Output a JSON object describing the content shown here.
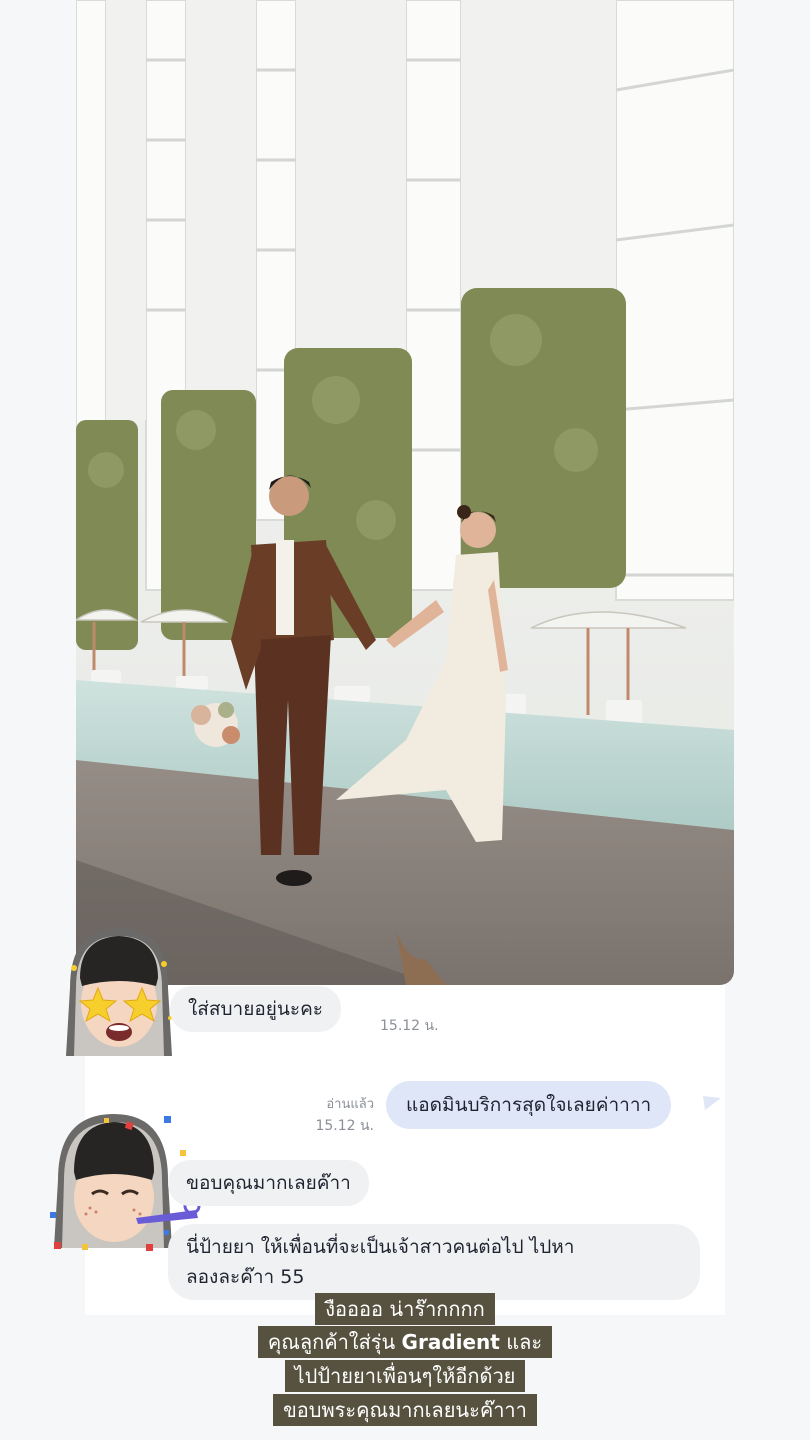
{
  "photo": {
    "name": "wedding-couple-photo",
    "colors": {
      "building": "#eef0ee",
      "hedge": "#7f8a55",
      "pool": "#bfd6d2",
      "deck": "#8a837d"
    }
  },
  "chat": {
    "messages": [
      {
        "id": "m1",
        "side": "incoming",
        "text": "ใส่สบายอยู่นะคะ",
        "time": "15.12 น."
      },
      {
        "id": "m2",
        "side": "outgoing",
        "text": "แอดมินบริการสุดใจเลยค่าาาา",
        "read_label": "อ่านแล้ว",
        "time": "15.12 น."
      },
      {
        "id": "m3",
        "side": "incoming",
        "text": "ขอบคุณมากเลยค๊าา"
      },
      {
        "id": "m4",
        "side": "incoming",
        "lines": [
          "นี่ป้ายยา ให้เพื่อนที่จะเป็นเจ้าสาวคนต่อไป ไปหา",
          "ลองละค๊าา 55"
        ]
      }
    ],
    "colors": {
      "incoming_bubble": "#f0f1f3",
      "outgoing_bubble": "#dfe6f8"
    }
  },
  "caption": {
    "line1": "งืออออ น่าร๊ากกกก",
    "line2_prefix": "คุณลูกค้าใส่รุ่น ",
    "line2_bold": "Gradient",
    "line2_suffix": " และ",
    "line3": "ไปป้ายยาเพื่อนๆให้อีกด้วย",
    "line4": "ขอบพระคุณมากเลยนะค๊าาา",
    "background": "#56523f"
  }
}
